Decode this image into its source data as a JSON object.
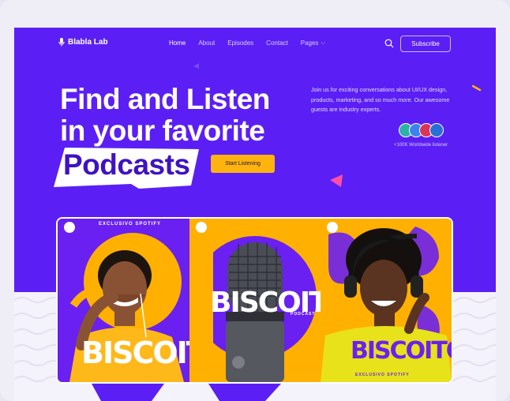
{
  "nav": {
    "logo": "Blabla Lab",
    "items": [
      {
        "label": "Home",
        "active": true
      },
      {
        "label": "About"
      },
      {
        "label": "Episodes"
      },
      {
        "label": "Contact"
      },
      {
        "label": "Pages"
      }
    ],
    "subscribe": "Subscribe"
  },
  "hero": {
    "line1": "Find and Listen",
    "line2": "in your favorite",
    "line3": "Podcasts",
    "cta": "Start Listening",
    "description": "Join us for exciting conversations about UI/UX design, products, marketing, and so much more. Our awesome guests are industry experts.",
    "listeners": "+100K Worldwide listener"
  },
  "cards": {
    "tag1": "EXCLUSIVO SPOTIFY",
    "tag3": "EXCLUSIVO SPOTIFY",
    "brand": "BISCOITO",
    "brand_sub": "PODCAST"
  },
  "colors": {
    "primary": "#5b1ff5",
    "accent": "#ffb30f",
    "pink": "#ff4fa3"
  },
  "icons": [
    "mic-icon",
    "search-icon",
    "chevron-down-icon",
    "spotify-icon"
  ]
}
